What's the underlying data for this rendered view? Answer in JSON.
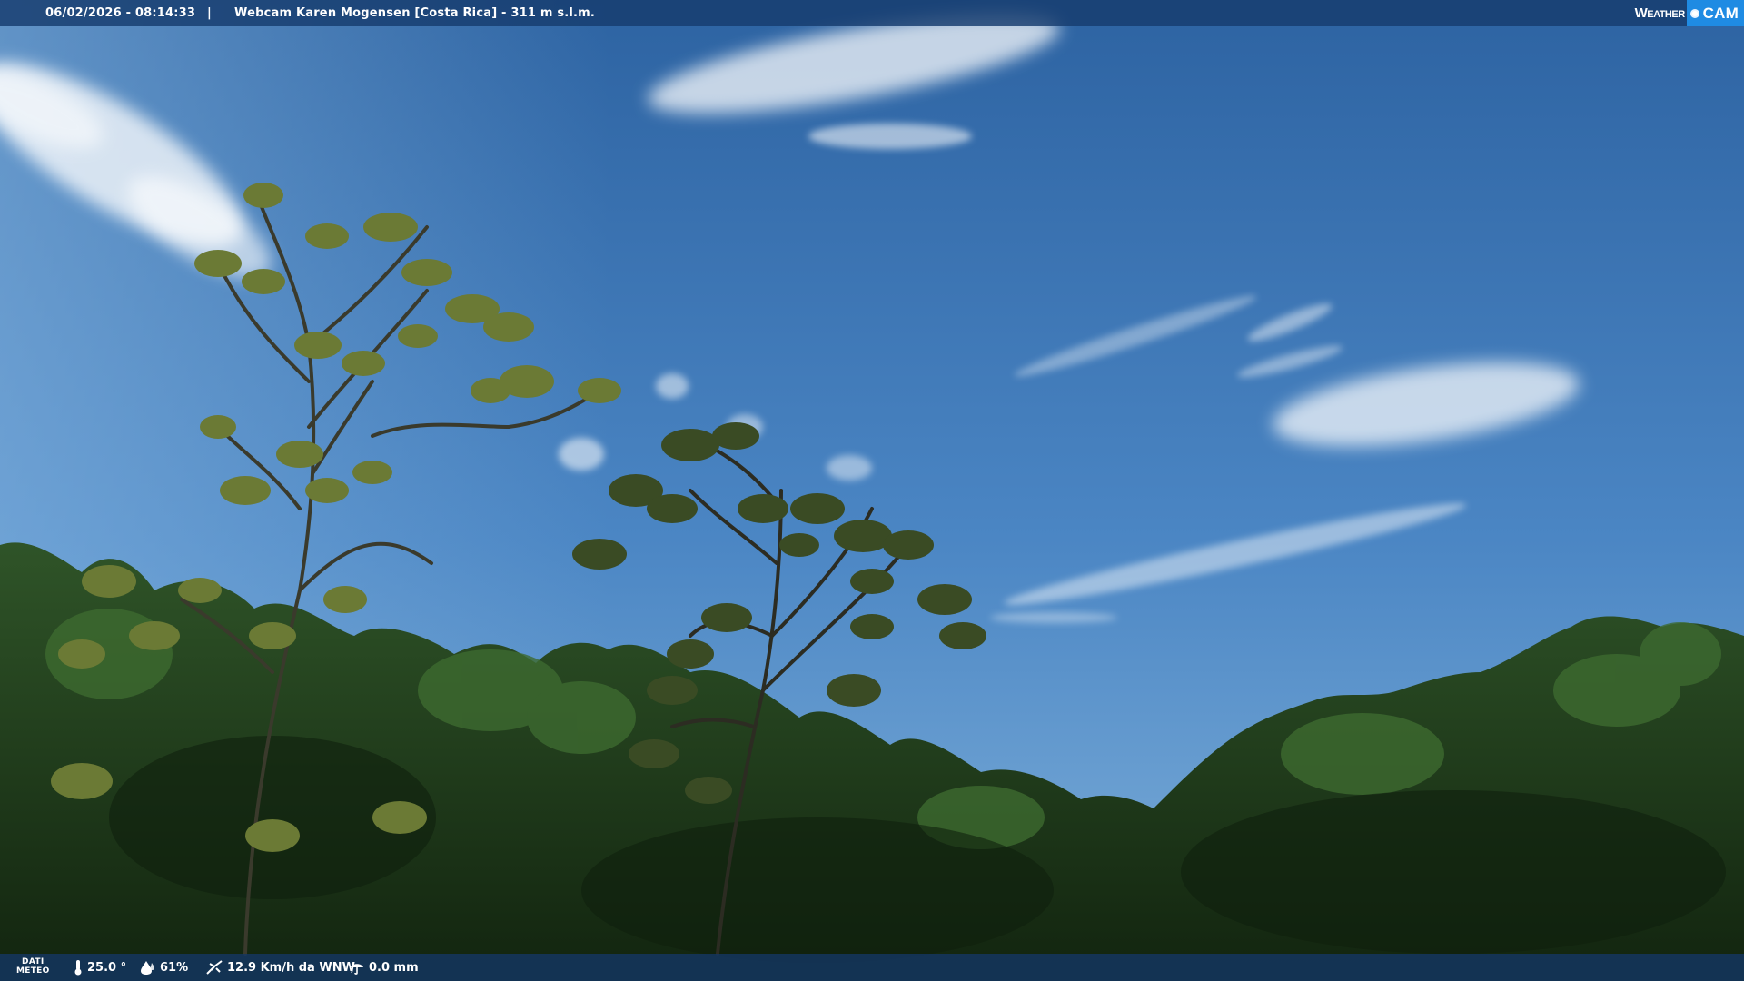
{
  "header": {
    "datetime": "06/02/2026 - 08:14:33",
    "separator": "|",
    "title": "Webcam Karen Mogensen [Costa Rica]  - 311 m s.l.m."
  },
  "brand": {
    "weather": "Weather",
    "cam": "CAM",
    "accent_color": "#1f8be3"
  },
  "footer": {
    "meteo_label_line1": "DATI",
    "meteo_label_line2": "METEO",
    "temperature": "25.0 °",
    "temperature_icon": "thermometer-icon",
    "humidity": "61%",
    "humidity_icon": "humidity-drop-icon",
    "wind": "12.9 Km/h da WNW",
    "wind_icon": "wind-icon",
    "rain": "0.0 mm",
    "rain_icon": "rain-icon"
  },
  "colors": {
    "sky_top": "#2f6aa8",
    "sky_bottom": "#6aa3d6",
    "foliage": "#1f3a1c"
  }
}
